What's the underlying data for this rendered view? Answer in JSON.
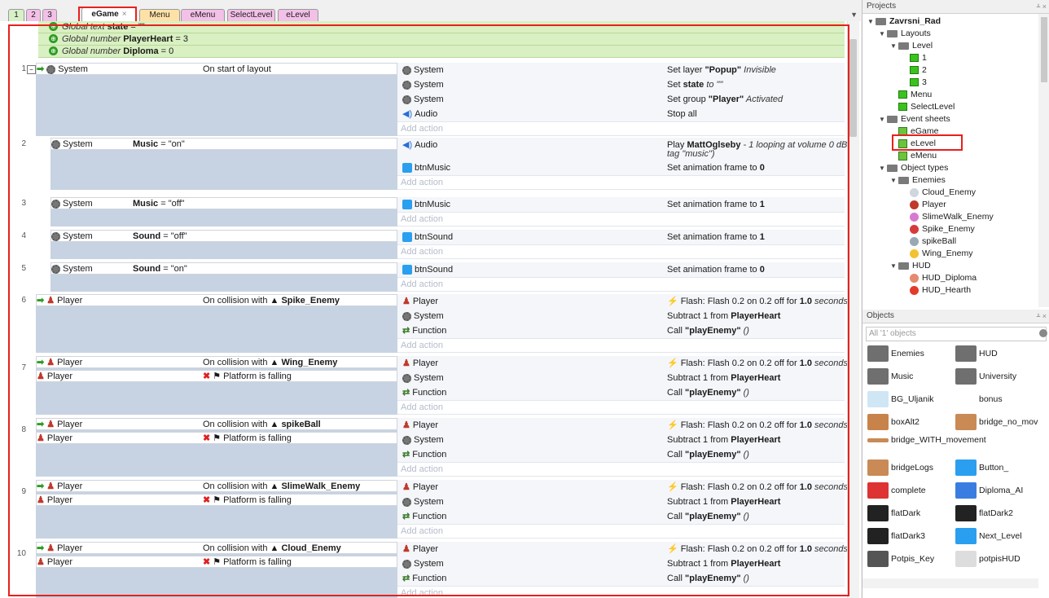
{
  "tabs": [
    "1",
    "2",
    "3",
    "eGame",
    "Menu",
    "eMenu",
    "SelectLevel",
    "eLevel"
  ],
  "tab_close_glyph": "×",
  "tab_colors": [
    "#d8f0c8",
    "#f3c0e8",
    "#f3c0e8",
    "#fff",
    "#ffe1a8",
    "#f3c0e8",
    "#f3c0e8",
    "#f3c0e8"
  ],
  "globals": [
    {
      "kind": "Global text",
      "name": "state",
      "rest": " = \"\""
    },
    {
      "kind": "Global number",
      "name": "PlayerHeart",
      "rest": " = 3"
    },
    {
      "kind": "Global number",
      "name": "Diploma",
      "rest": " = 0"
    }
  ],
  "add_action": "Add action",
  "events": [
    {
      "num": "1",
      "cond_obj": "System",
      "cond": "On start of layout",
      "actions": [
        {
          "obj": "System",
          "desc_pre": "Set layer ",
          "desc_b": "\"Popup\"",
          "desc_post": " Invisible"
        },
        {
          "obj": "System",
          "desc_pre": "Set ",
          "desc_b": "state",
          "desc_post": " to \"\""
        },
        {
          "obj": "System",
          "desc_pre": "Set group ",
          "desc_b": "\"Player\"",
          "desc_post": " Activated"
        },
        {
          "obj": "Audio",
          "desc_pre": "Stop all",
          "desc_b": "",
          "desc_post": ""
        }
      ]
    },
    {
      "num": "2",
      "cond_obj": "System",
      "cond_b": "Music",
      "cond": " = \"on\"",
      "actions": [
        {
          "obj": "Audio",
          "desc_pre": "Play ",
          "desc_b": "MattOglseby",
          "desc_post": " - 1 looping at volume 0 dB (",
          "line2": "tag \"music\")"
        },
        {
          "obj": "btnMusic",
          "desc_pre": "Set animation frame to ",
          "desc_b": "0",
          "desc_post": ""
        }
      ]
    },
    {
      "num": "3",
      "cond_obj": "System",
      "cond_b": "Music",
      "cond": " = \"off\"",
      "actions": [
        {
          "obj": "btnMusic",
          "desc_pre": "Set animation frame to ",
          "desc_b": "1",
          "desc_post": ""
        }
      ]
    },
    {
      "num": "4",
      "cond_obj": "System",
      "cond_b": "Sound",
      "cond": " = \"off\"",
      "actions": [
        {
          "obj": "btnSound",
          "desc_pre": "Set animation frame to ",
          "desc_b": "1",
          "desc_post": ""
        }
      ]
    },
    {
      "num": "5",
      "cond_obj": "System",
      "cond_b": "Sound",
      "cond": " = \"on\"",
      "actions": [
        {
          "obj": "btnSound",
          "desc_pre": "Set animation frame to ",
          "desc_b": "0",
          "desc_post": ""
        }
      ]
    },
    {
      "num": "6",
      "cond_obj": "Player",
      "cond": "On collision with ",
      "cond_b": "Spike_Enemy",
      "actions": [
        {
          "obj": "Player",
          "desc_pre": "Flash: Flash 0.2 on 0.2 off for ",
          "desc_b": "1.0",
          "desc_post": " seconds"
        },
        {
          "obj": "System",
          "desc_pre": "Subtract 1 from ",
          "desc_b": "PlayerHeart",
          "desc_post": ""
        },
        {
          "obj": "Function",
          "desc_pre": "Call ",
          "desc_b": "\"playEnemy\"",
          "desc_post": " ()"
        }
      ]
    },
    {
      "num": "7",
      "cond_obj": "Player",
      "cond": "On collision with ",
      "cond_b": "Wing_Enemy",
      "cond2": "Platform is falling",
      "actions": [
        {
          "obj": "Player",
          "desc_pre": "Flash: Flash 0.2 on 0.2 off for ",
          "desc_b": "1.0",
          "desc_post": " seconds"
        },
        {
          "obj": "System",
          "desc_pre": "Subtract 1 from ",
          "desc_b": "PlayerHeart",
          "desc_post": ""
        },
        {
          "obj": "Function",
          "desc_pre": "Call ",
          "desc_b": "\"playEnemy\"",
          "desc_post": " ()"
        }
      ]
    },
    {
      "num": "8",
      "cond_obj": "Player",
      "cond": "On collision with ",
      "cond_b": "spikeBall",
      "cond2": "Platform is falling",
      "actions": [
        {
          "obj": "Player",
          "desc_pre": "Flash: Flash 0.2 on 0.2 off for ",
          "desc_b": "1.0",
          "desc_post": " seconds"
        },
        {
          "obj": "System",
          "desc_pre": "Subtract 1 from ",
          "desc_b": "PlayerHeart",
          "desc_post": ""
        },
        {
          "obj": "Function",
          "desc_pre": "Call ",
          "desc_b": "\"playEnemy\"",
          "desc_post": " ()"
        }
      ]
    },
    {
      "num": "9",
      "cond_obj": "Player",
      "cond": "On collision with ",
      "cond_b": "SlimeWalk_Enemy",
      "cond2": "Platform is falling",
      "actions": [
        {
          "obj": "Player",
          "desc_pre": "Flash: Flash 0.2 on 0.2 off for ",
          "desc_b": "1.0",
          "desc_post": " seconds"
        },
        {
          "obj": "System",
          "desc_pre": "Subtract 1 from ",
          "desc_b": "PlayerHeart",
          "desc_post": ""
        },
        {
          "obj": "Function",
          "desc_pre": "Call ",
          "desc_b": "\"playEnemy\"",
          "desc_post": " ()"
        }
      ]
    },
    {
      "num": "10",
      "cond_obj": "Player",
      "cond": "On collision with ",
      "cond_b": "Cloud_Enemy",
      "cond2": "Platform is falling",
      "actions": [
        {
          "obj": "Player",
          "desc_pre": "Flash: Flash 0.2 on 0.2 off for ",
          "desc_b": "1.0",
          "desc_post": " seconds"
        },
        {
          "obj": "System",
          "desc_pre": "Subtract 1 from ",
          "desc_b": "PlayerHeart",
          "desc_post": ""
        },
        {
          "obj": "Function",
          "desc_pre": "Call ",
          "desc_b": "\"playEnemy\"",
          "desc_post": " ()"
        }
      ]
    }
  ],
  "projects": {
    "title": "Projects",
    "pin_glyph": "ᚆ ×",
    "tree": [
      {
        "label": "Zavrsni_Rad",
        "type": "folder",
        "depth": 0,
        "bold": true
      },
      {
        "label": "Layouts",
        "type": "folder",
        "depth": 1
      },
      {
        "label": "Level",
        "type": "folder",
        "depth": 2
      },
      {
        "label": "1",
        "type": "layout",
        "depth": 3
      },
      {
        "label": "2",
        "type": "layout",
        "depth": 3
      },
      {
        "label": "3",
        "type": "layout",
        "depth": 3
      },
      {
        "label": "Menu",
        "type": "layout",
        "depth": 2
      },
      {
        "label": "SelectLevel",
        "type": "layout",
        "depth": 2
      },
      {
        "label": "Event sheets",
        "type": "folder",
        "depth": 1
      },
      {
        "label": "eGame",
        "type": "sheet",
        "depth": 2
      },
      {
        "label": "eLevel",
        "type": "sheet",
        "depth": 2
      },
      {
        "label": "eMenu",
        "type": "sheet",
        "depth": 2
      },
      {
        "label": "Object types",
        "type": "folder",
        "depth": 1
      },
      {
        "label": "Enemies",
        "type": "folder",
        "depth": 2
      },
      {
        "label": "Cloud_Enemy",
        "type": "obj",
        "depth": 3,
        "icon_color": "#cfd6dd"
      },
      {
        "label": "Player",
        "type": "obj",
        "depth": 3,
        "icon_color": "#c0392b"
      },
      {
        "label": "SlimeWalk_Enemy",
        "type": "obj",
        "depth": 3,
        "icon_color": "#d67ad1"
      },
      {
        "label": "Spike_Enemy",
        "type": "obj",
        "depth": 3,
        "icon_color": "#d63b3b"
      },
      {
        "label": "spikeBall",
        "type": "obj",
        "depth": 3,
        "icon_color": "#9aa8b5"
      },
      {
        "label": "Wing_Enemy",
        "type": "obj",
        "depth": 3,
        "icon_color": "#f2c230"
      },
      {
        "label": "HUD",
        "type": "folder",
        "depth": 2
      },
      {
        "label": "HUD_Diploma",
        "type": "obj",
        "depth": 3,
        "icon_color": "#e58a6d"
      },
      {
        "label": "HUD_Hearth",
        "type": "obj",
        "depth": 3,
        "icon_color": "#e23b2b"
      }
    ]
  },
  "objects": {
    "title": "Objects",
    "pin_glyph": "ᚆ ×",
    "search_placeholder": "All '1' objects",
    "items": [
      {
        "label": "Enemies",
        "color": "#6f6f6f"
      },
      {
        "label": "HUD",
        "color": "#6f6f6f"
      },
      {
        "label": "Music",
        "color": "#6f6f6f"
      },
      {
        "label": "University",
        "color": "#6f6f6f"
      },
      {
        "label": "BG_Uljanik",
        "color": "#cfe6f5"
      },
      {
        "label": "bonus",
        "color": "#ffffff"
      },
      {
        "label": "boxAlt2",
        "color": "#c8834a"
      },
      {
        "label": "bridge_no_movement",
        "color": "#c98a55"
      },
      {
        "label": "bridge_WITH_movement",
        "color": "#c98a55"
      },
      {
        "label": "bridgeLogs",
        "color": "#c98a55"
      },
      {
        "label": "Button_",
        "color": "#2a9ff0"
      },
      {
        "label": "complete",
        "color": "#d33"
      },
      {
        "label": "Diploma_AI",
        "color": "#3a7de0"
      },
      {
        "label": "flatDark",
        "color": "#222"
      },
      {
        "label": "flatDark2",
        "color": "#222"
      },
      {
        "label": "flatDark3",
        "color": "#222"
      },
      {
        "label": "Next_Level",
        "color": "#2a9ff0"
      },
      {
        "label": "Potpis_Key",
        "color": "#555"
      },
      {
        "label": "potpisHUD",
        "color": "#ddd"
      }
    ]
  }
}
